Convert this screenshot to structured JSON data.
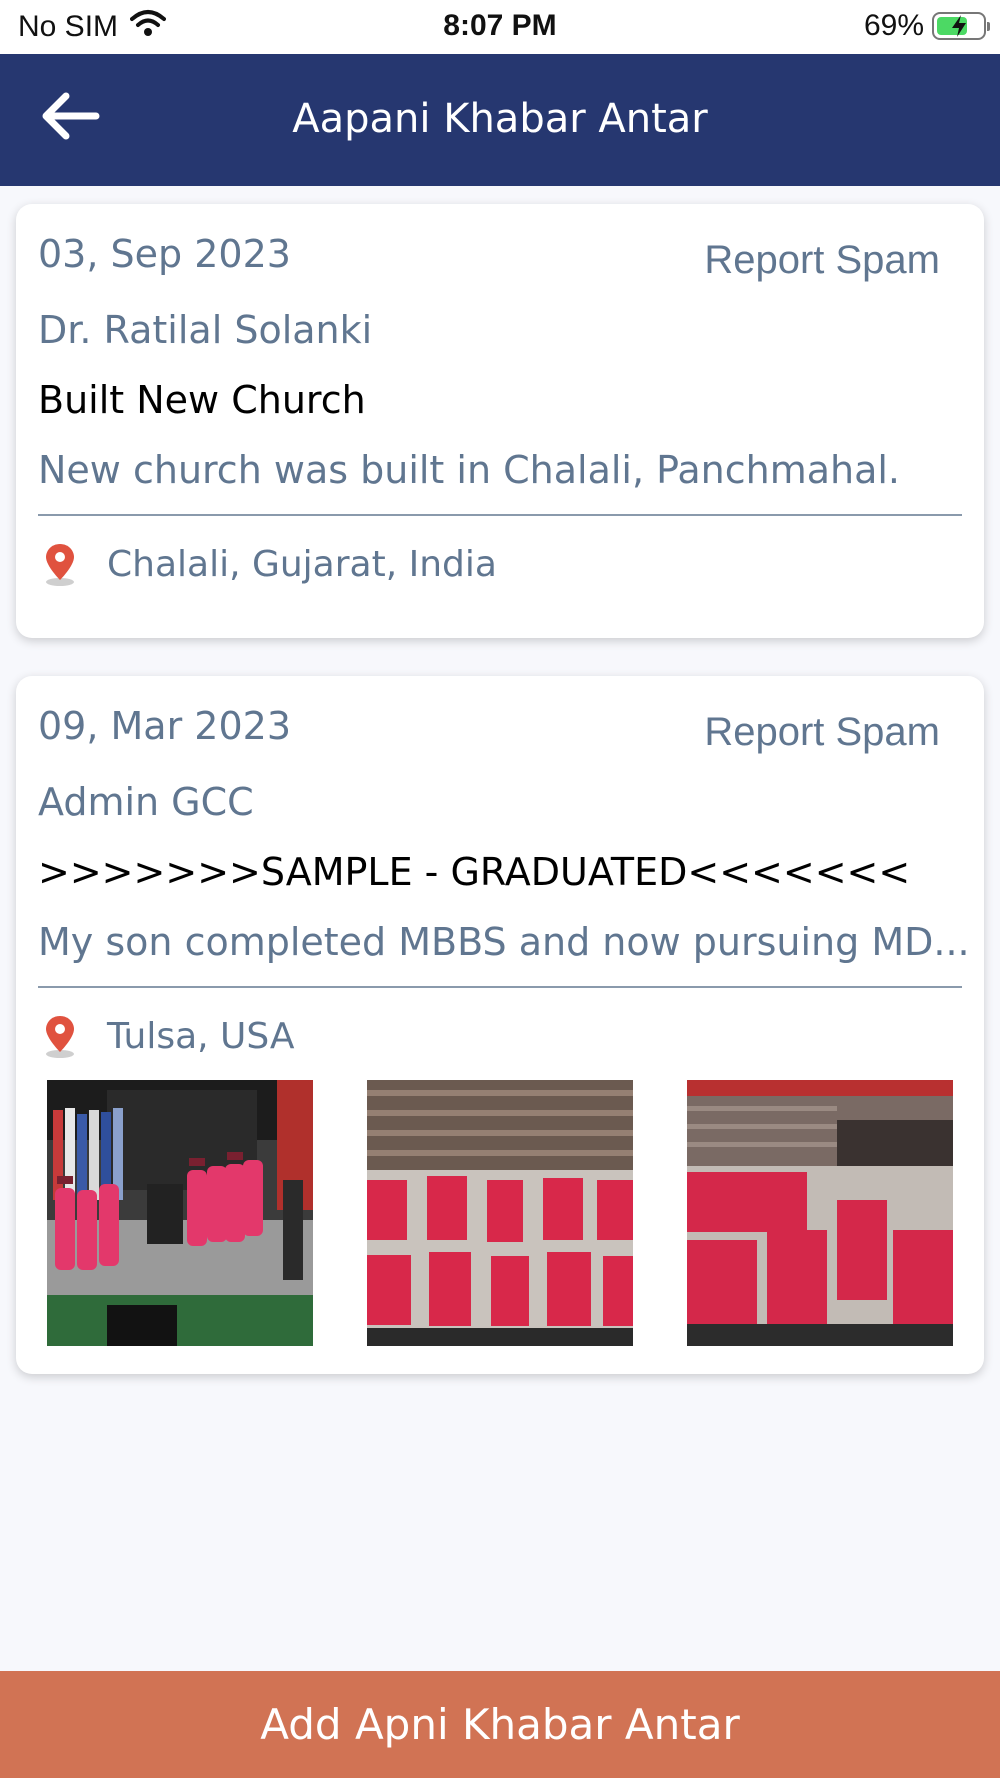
{
  "status": {
    "carrier": "No SIM",
    "time": "8:07 PM",
    "battery": "69%",
    "battery_level": 0.69
  },
  "header": {
    "title": "Aapani Khabar Antar"
  },
  "posts": [
    {
      "date": "03, Sep 2023",
      "report_label": "Report Spam",
      "author": "Dr. Ratilal Solanki",
      "title": "Built New Church",
      "description": "New church was built in Chalali, Panchmahal.",
      "location": "Chalali, Gujarat, India"
    },
    {
      "date": "09, Mar 2023",
      "report_label": "Report Spam",
      "author": "Admin GCC",
      "title": ">>>>>>>SAMPLE - GRADUATED<<<<<<<",
      "description": "My son completed MBBS and now pursuing MD...",
      "location": "Tulsa, USA"
    }
  ],
  "footer": {
    "add_label": "Add Apni Khabar Antar"
  },
  "colors": {
    "header_bg": "#263770",
    "accent_button": "#d17354",
    "muted_text": "#607690",
    "pin": "#e0523f"
  }
}
